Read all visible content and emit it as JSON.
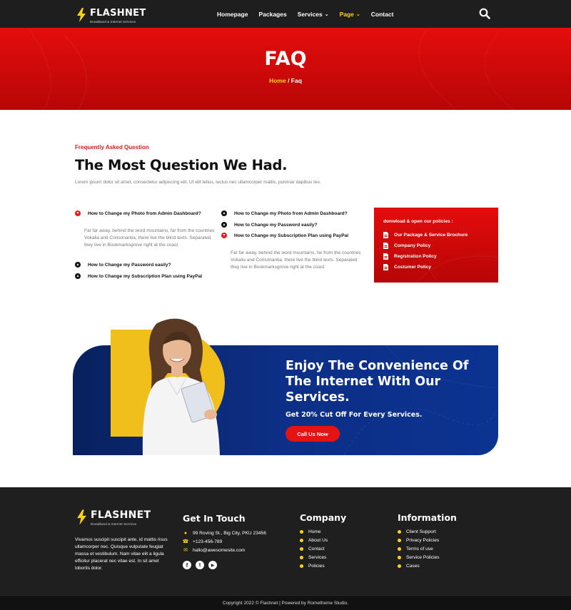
{
  "header": {
    "brand": "FLASHNET",
    "brand_tagline": "Broadband & Internet Services",
    "menu": [
      {
        "label": "Homepage",
        "active": false,
        "dropdown": false
      },
      {
        "label": "Packages",
        "active": false,
        "dropdown": false
      },
      {
        "label": "Services",
        "active": false,
        "dropdown": true
      },
      {
        "label": "Page",
        "active": true,
        "dropdown": true
      },
      {
        "label": "Contact",
        "active": false,
        "dropdown": false
      }
    ],
    "search_icon": "search-icon"
  },
  "hero": {
    "title": "FAQ",
    "breadcrumb_home": "Home",
    "breadcrumb_sep": " / ",
    "breadcrumb_current": "Faq"
  },
  "faq": {
    "eyebrow": "Frequently Asked Question",
    "heading": "The Most Question We Had.",
    "lead": "Lorem ipsum dolor sit amet, consectetur adipiscing elit. Ut elit tellus, luctus nec ullamcorper mattis, pulvinar dapibus leo.",
    "left": {
      "q1": "How to Change my Photo from Admin Dashboard?",
      "a1": "Far far away, behind the word mountains, far from the countries Vokalia and Consonantia, there live the blind texts. Separated they live in Bookmarksgrove right at the coast",
      "q2": "How to Change my Password easily?",
      "q3": "How to Change my Subscription Plan using PayPal"
    },
    "right": {
      "q1": "How to Change my Photo from Admin Dashboard?",
      "q2": "How to Change my Password easily?",
      "q3": "How to Change my Subscription Plan using PayPal",
      "a3": "Far far away, behind the word mountains, far from the countries Vokalia and Consonantia, there live the blind texts. Separated they live in Bookmarksgrove right at the coast"
    }
  },
  "policies": {
    "title": "donwload & open our policies :",
    "items": [
      "Our Package & Service Brochure",
      "Company Policy",
      "Registration Policy",
      "Costumer Policy"
    ]
  },
  "cta": {
    "title": "Enjoy The Convenience Of The Internet With Our Services.",
    "subtitle": "Get 20% Cut Off For Every Services.",
    "button": "Call Us Now"
  },
  "footer": {
    "brand": "FLASHNET",
    "brand_tagline": "Broadband & Internet Services",
    "description": "Vivamus suscipit suscipit ante, id mattis risus ullamcorper nec. Quisque vulputate feugiat massa et vestibulum. Nam vitae elit a ligula efficitur placerat nec vitae est. In sit amet lobortis dolor.",
    "contact_title": "Get In Touch",
    "address": "99 Roving St., Big City, PKU 23456",
    "phone": "+123-456-789",
    "email": "hallo@awesomesite.com",
    "social_icons": [
      "facebook-icon",
      "twitter-icon",
      "youtube-icon"
    ],
    "company_title": "Company",
    "company_links": [
      "Home",
      "About Us",
      "Contact",
      "Services",
      "Policies"
    ],
    "info_title": "Information",
    "info_links": [
      "Client Support",
      "Privacy Policies",
      "Terms of use",
      "Service Policies",
      "Cases"
    ],
    "copyright": "Copyright 2022 © Flashnet | Powered by Rometheme Studio."
  },
  "colors": {
    "accent_red": "#e41b1b",
    "accent_yellow": "#ffd21a",
    "navy": "#0d2f86",
    "dark": "#1f1f1f"
  }
}
